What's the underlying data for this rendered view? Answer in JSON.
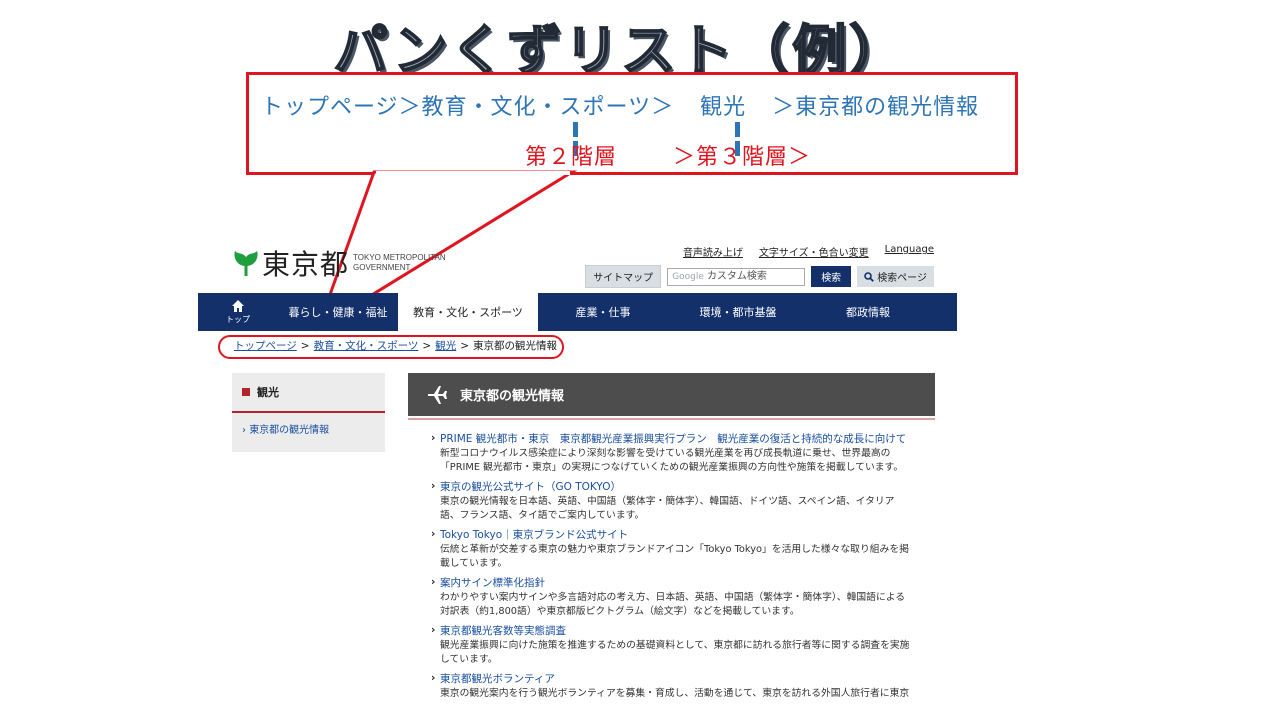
{
  "slide": {
    "title": "パンくずリスト（例）",
    "line1": [
      "トップページ＞教育・文化・スポーツ＞",
      "観光",
      "＞東京都の観光情報"
    ],
    "level2": "第２階層",
    "level3": "＞第３階層＞"
  },
  "site": {
    "logo_text": "東京都",
    "logo_sub": [
      "TOKYO METROPOLITAN",
      "GOVERNMENT"
    ],
    "util_links": [
      "音声読み上げ",
      "文字サイズ・色合い変更",
      "Language"
    ],
    "sitemap_label": "サイトマップ",
    "search_placeholder_prefix": "Google",
    "search_placeholder": "カスタム検索",
    "search_button": "検索",
    "search_page_button": "検索ページ",
    "nav": {
      "home": "トップ",
      "items": [
        "暮らし・健康・福祉",
        "教育・文化・スポーツ",
        "産業・仕事",
        "環境・都市基盤",
        "都政情報"
      ]
    },
    "breadcrumb": [
      "トップページ",
      "教育・文化・スポーツ",
      "観光",
      "東京都の観光情報"
    ],
    "side_heading": "観光",
    "side_item": "東京都の観光情報",
    "main_heading": "東京都の観光情報",
    "list": [
      {
        "title": "PRIME 観光都市・東京　東京都観光産業振興実行プラン　観光産業の復活と持続的な成長に向けて",
        "desc": [
          "新型コロナウイルス感染症により深刻な影響を受けている観光産業を再び成長軌道に乗せ、世界最高の",
          "「PRIME 観光都市・東京」の実現につなげていくための観光産業振興の方向性や施策を掲載しています。"
        ]
      },
      {
        "title": "東京の観光公式サイト（GO TOKYO）",
        "desc": [
          "東京の観光情報を日本語、英語、中国語（繁体字・簡体字）、韓国語、ドイツ語、スペイン語、イタリア",
          "語、フランス語、タイ語でご案内しています。"
        ]
      },
      {
        "title": "Tokyo Tokyo｜東京ブランド公式サイト",
        "desc": [
          "伝統と革新が交差する東京の魅力や東京ブランドアイコン「Tokyo Tokyo」を活用した様々な取り組みを掲",
          "載しています。"
        ]
      },
      {
        "title": "案内サイン標準化指針",
        "desc": [
          "わかりやすい案内サインや多言語対応の考え方、日本語、英語、中国語（繁体字・簡体字）、韓国語による",
          "対訳表（約1,800語）や東京都版ピクトグラム（絵文字）などを掲載しています。"
        ]
      },
      {
        "title": "東京都観光客数等実態調査",
        "desc": [
          "観光産業振興に向けた施策を推進するための基礎資料として、東京都に訪れる旅行者等に関する調査を実施",
          "しています。"
        ]
      },
      {
        "title": "東京都観光ボランティア",
        "desc": [
          "東京の観光案内を行う観光ボランティアを募集・育成し、活動を通じて、東京を訪れる外国人旅行者に東京",
          ""
        ]
      }
    ]
  },
  "colors": {
    "callout_red": "#e0141e",
    "slide_blue": "#2e75b6",
    "nav_navy": "#13306b",
    "link_blue": "#1a4fa0"
  }
}
